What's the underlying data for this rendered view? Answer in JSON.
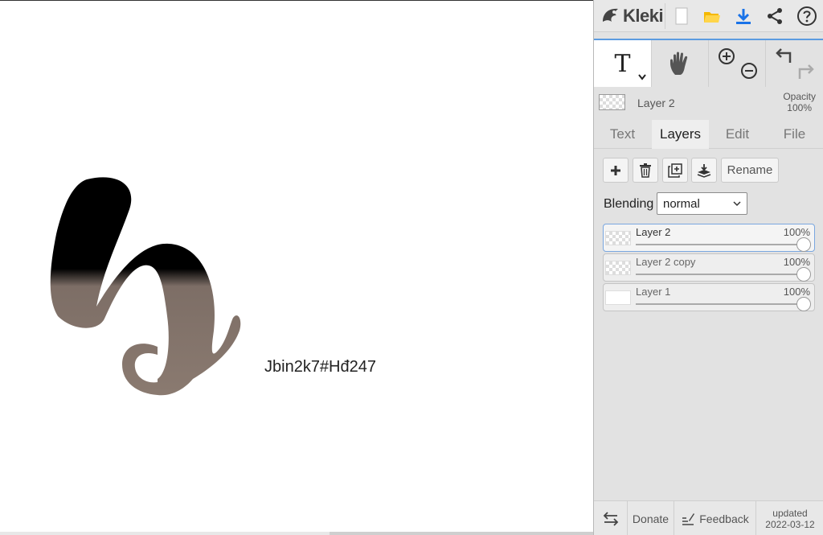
{
  "canvas": {
    "text": "Jbin2k7#Hđ247"
  },
  "header": {
    "brand": "Kleki",
    "icons": [
      "new-document-icon",
      "open-folder-icon",
      "download-icon",
      "share-icon",
      "help-icon"
    ],
    "accent_color": "#1a73e8",
    "folder_color": "#f5b800"
  },
  "tools": {
    "active": "text",
    "text_glyph": "T",
    "items": [
      "text-tool",
      "hand-tool",
      "zoom-tool",
      "undo-redo"
    ]
  },
  "layer_info": {
    "name": "Layer 2",
    "opacity_label": "Opacity",
    "opacity_value": "100%"
  },
  "tabs": [
    {
      "label": "Text",
      "active": false
    },
    {
      "label": "Layers",
      "active": true
    },
    {
      "label": "Edit",
      "active": false
    },
    {
      "label": "File",
      "active": false
    }
  ],
  "layers_panel": {
    "rename_label": "Rename",
    "blending_label": "Blending",
    "blending_value": "normal",
    "layers": [
      {
        "name": "Layer 2",
        "opacity": "100%",
        "selected": true
      },
      {
        "name": "Layer 2 copy",
        "opacity": "100%",
        "selected": false
      },
      {
        "name": "Layer 1",
        "opacity": "100%",
        "selected": false
      }
    ]
  },
  "footer": {
    "donate": "Donate",
    "feedback": "Feedback",
    "updated_label": "updated",
    "updated_date": "2022-03-12"
  }
}
